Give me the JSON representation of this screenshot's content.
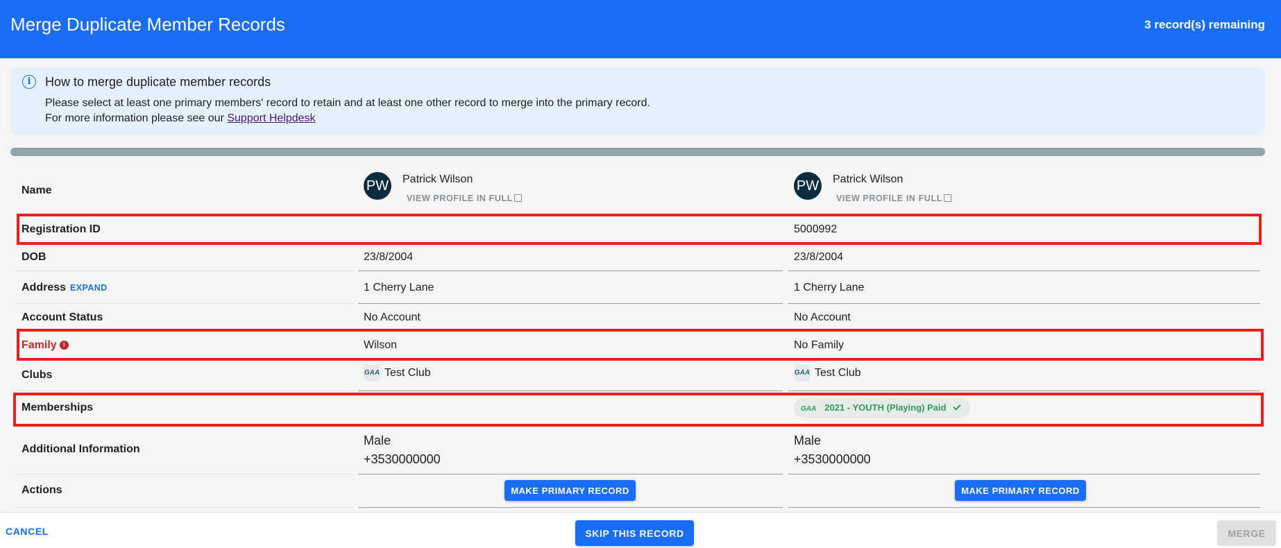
{
  "header": {
    "title": "Merge Duplicate Member Records",
    "remaining": "3 record(s) remaining"
  },
  "info": {
    "heading": "How to merge duplicate member records",
    "line1": "Please select at least one primary members' record to retain and at least one other record to merge into the primary record.",
    "line2_prefix": "For more information please see our ",
    "link": "Support Helpdesk"
  },
  "labels": {
    "name": "Name",
    "registration_id": "Registration ID",
    "dob": "DOB",
    "address": "Address",
    "expand": "EXPAND",
    "account_status": "Account Status",
    "family": "Family",
    "clubs": "Clubs",
    "memberships": "Memberships",
    "additional_info": "Additional Information",
    "actions": "Actions"
  },
  "records": [
    {
      "initials": "PW",
      "name": "Patrick Wilson",
      "view_profile": "VIEW PROFILE IN FULL",
      "registration_id": "",
      "dob": "23/8/2004",
      "address": "1 Cherry Lane",
      "account_status": "No Account",
      "family": "Wilson",
      "club": "Test Club",
      "membership": "",
      "gender": "Male",
      "phone": "+3530000000",
      "action": "MAKE PRIMARY RECORD"
    },
    {
      "initials": "PW",
      "name": "Patrick Wilson",
      "view_profile": "VIEW PROFILE IN FULL",
      "registration_id": "5000992",
      "dob": "23/8/2004",
      "address": "1 Cherry Lane",
      "account_status": "No Account",
      "family": "No Family",
      "club": "Test Club",
      "membership": "2021 - YOUTH (Playing) Paid",
      "gender": "Male",
      "phone": "+3530000000",
      "action": "MAKE PRIMARY RECORD"
    }
  ],
  "footer": {
    "cancel": "CANCEL",
    "skip": "SKIP THIS RECORD",
    "merge": "MERGE"
  },
  "colors": {
    "brand": "#1a6ef5",
    "highlight": "#e8201a",
    "membership_green": "#2e9e4e"
  }
}
